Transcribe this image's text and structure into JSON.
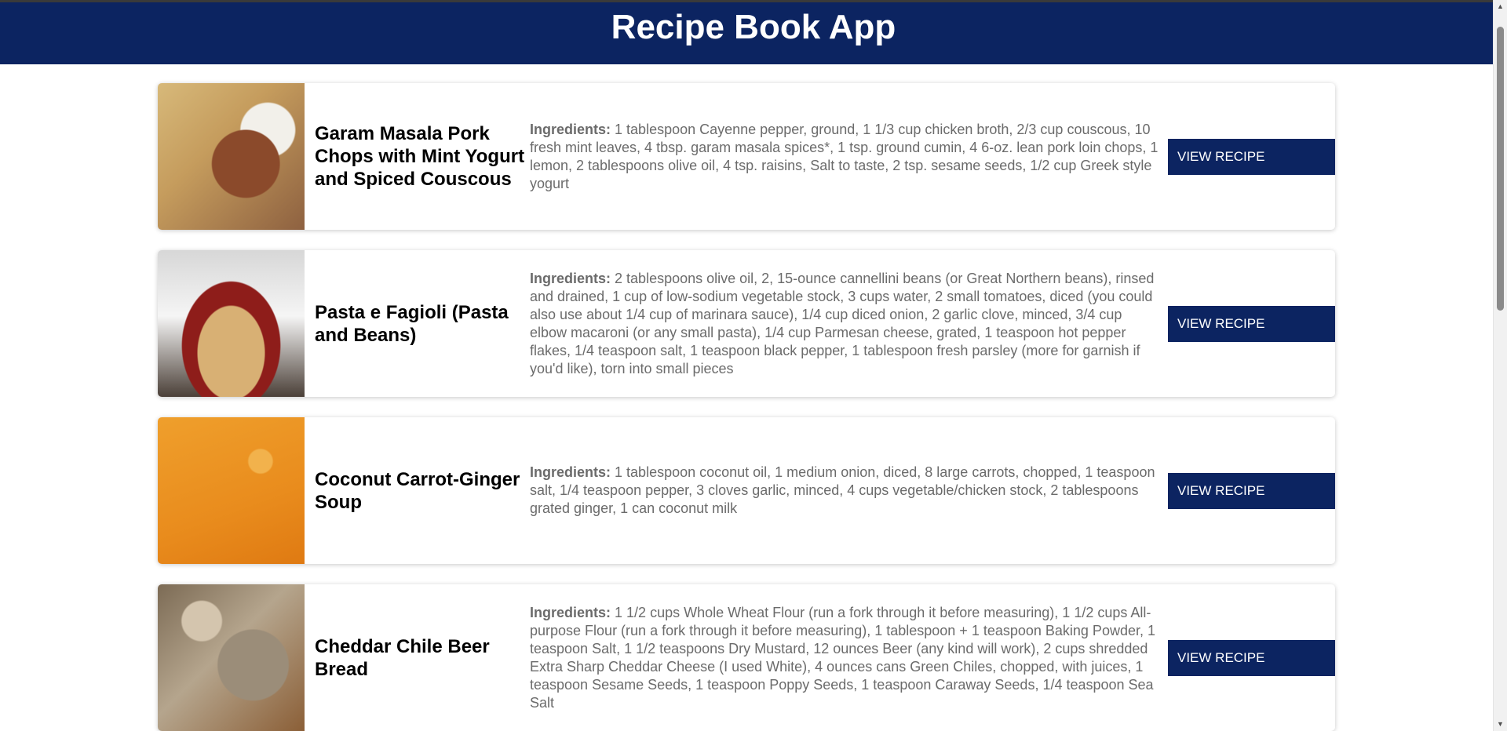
{
  "header": {
    "title": "Recipe Book App"
  },
  "recipes": [
    {
      "name": "Garam Masala Pork Chops with Mint Yogurt and Spiced Couscous",
      "ingredients_label": "Ingredients:",
      "ingredients": "1 tablespoon Cayenne pepper, ground, 1 1/3 cup chicken broth, 2/3 cup couscous, 10 fresh mint leaves, 4 tbsp. garam masala spices*, 1 tsp. ground cumin, 4 6-oz. lean pork loin chops, 1 lemon, 2 tablespoons olive oil, 4 tsp. raisins, Salt to taste, 2 tsp. sesame seeds, 1/2 cup Greek style yogurt",
      "button_label": "VIEW RECIPE"
    },
    {
      "name": "Pasta e Fagioli (Pasta and Beans)",
      "ingredients_label": "Ingredients:",
      "ingredients": "2 tablespoons olive oil, 2, 15-ounce cannellini beans (or Great Northern beans), rinsed and drained, 1 cup of low-sodium vegetable stock, 3 cups water, 2 small tomatoes, diced (you could also use about 1/4 cup of marinara sauce), 1/4 cup diced onion, 2 garlic clove, minced, 3/4 cup elbow macaroni (or any small pasta), 1/4 cup Parmesan cheese, grated, 1 teaspoon hot pepper flakes, 1/4 teaspoon salt, 1 teaspoon black pepper, 1 tablespoon fresh parsley (more for garnish if you'd like), torn into small pieces",
      "button_label": "VIEW RECIPE"
    },
    {
      "name": "Coconut Carrot-Ginger Soup",
      "ingredients_label": "Ingredients:",
      "ingredients": "1 tablespoon coconut oil, 1 medium onion, diced, 8 large carrots, chopped, 1 teaspoon salt, 1/4 teaspoon pepper, 3 cloves garlic, minced, 4 cups vegetable/chicken stock, 2 tablespoons grated ginger, 1 can coconut milk",
      "button_label": "VIEW RECIPE"
    },
    {
      "name": "Cheddar Chile Beer Bread",
      "ingredients_label": "Ingredients:",
      "ingredients": "1 1/2 cups Whole Wheat Flour (run a fork through it before measuring), 1 1/2 cups All-purpose Flour (run a fork through it before measuring), 1 tablespoon + 1 teaspoon Baking Powder, 1 teaspoon Salt, 1 1/2 teaspoons Dry Mustard, 12 ounces Beer (any kind will work), 2 cups shredded Extra Sharp Cheddar Cheese (I used White), 4 ounces cans Green Chiles, chopped, with juices, 1 teaspoon Sesame Seeds, 1 teaspoon Poppy Seeds, 1 teaspoon Caraway Seeds, 1/4 teaspoon Sea Salt",
      "button_label": "VIEW RECIPE"
    }
  ],
  "colors": {
    "header_bg": "#0c2461",
    "button_bg": "#0c2461",
    "text_muted": "#6b6b6b"
  }
}
